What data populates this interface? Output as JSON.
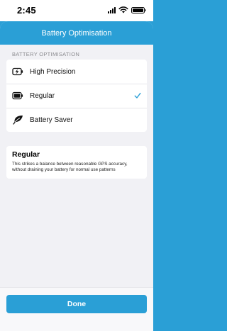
{
  "status_bar": {
    "time": "2:45"
  },
  "header": {
    "title": "Battery Optimisation"
  },
  "section": {
    "label": "BATTERY OPTIMISATION"
  },
  "options": [
    {
      "label": "High Precision",
      "icon": "battery-charging-icon",
      "selected": false
    },
    {
      "label": "Regular",
      "icon": "battery-full-icon",
      "selected": true
    },
    {
      "label": "Battery Saver",
      "icon": "leaf-icon",
      "selected": false
    }
  ],
  "description": {
    "title": "Regular",
    "text": "This strikes a balance between reasonable GPS accuracy, without draining your battery for normal use patterns"
  },
  "footer": {
    "done_label": "Done"
  },
  "colors": {
    "accent": "#2a9fd6",
    "background": "#f1f1f5"
  }
}
